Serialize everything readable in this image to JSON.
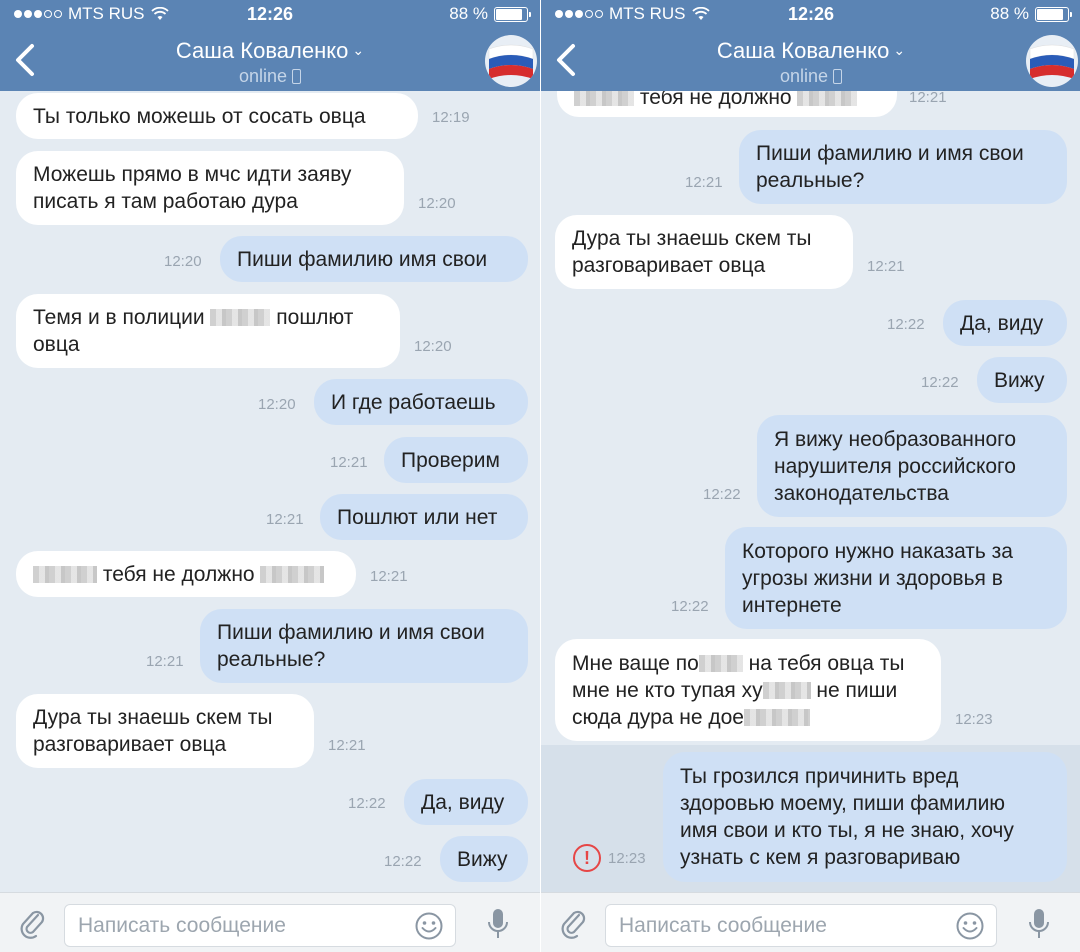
{
  "status_bar": {
    "carrier": "MTS RUS",
    "time": "12:26",
    "battery": "88 %",
    "battery_level": 0.88
  },
  "header": {
    "contact_name": "Саша Коваленко",
    "contact_status": "online",
    "icons": [
      "back-chevron-icon",
      "chevron-down-icon",
      "mobile-phone-icon",
      "avatar-russian-flag"
    ]
  },
  "composer": {
    "placeholder": "Написать сообщение",
    "icons": [
      "paperclip-icon",
      "emoji-icon",
      "microphone-icon"
    ]
  },
  "colors": {
    "header": "#5b84b4",
    "background": "#e4ebf2",
    "bubble_in": "#ffffff",
    "bubble_out": "#cfe0f5",
    "time_text": "#9aa5b1",
    "error": "#e64646"
  },
  "screens": [
    {
      "messages": [
        {
          "dir": "in",
          "text": "Ты только можешь от сосать овца",
          "time": "12:19"
        },
        {
          "dir": "in",
          "text": "Можешь прямо в мчс идти заяву\nписать я там работаю дура",
          "time": "12:20"
        },
        {
          "dir": "out",
          "text": "Пиши фамилию имя свои",
          "time": "12:20"
        },
        {
          "dir": "in",
          "text": "Темя и в полиции [censored] пошлют\nовца",
          "time": "12:20"
        },
        {
          "dir": "out",
          "text": "И где работаешь",
          "time": "12:20"
        },
        {
          "dir": "out",
          "text": "Проверим",
          "time": "12:21"
        },
        {
          "dir": "out",
          "text": "Пошлют или нет",
          "time": "12:21"
        },
        {
          "dir": "in",
          "text": "[censored] тебя не должно [censored]",
          "time": "12:21"
        },
        {
          "dir": "out",
          "text": "Пиши фамилию и имя свои\nреальные?",
          "time": "12:21"
        },
        {
          "dir": "in",
          "text": "Дура ты знаешь скем ты\nразговаривает овца",
          "time": "12:21"
        },
        {
          "dir": "out",
          "text": "Да, виду",
          "time": "12:22"
        },
        {
          "dir": "out",
          "text": "Вижу",
          "time": "12:22"
        }
      ]
    },
    {
      "messages": [
        {
          "dir": "in",
          "text": "[censored] тебя не должно [censored]",
          "time": "12:21"
        },
        {
          "dir": "out",
          "text": "Пиши фамилию и имя свои\nреальные?",
          "time": "12:21"
        },
        {
          "dir": "in",
          "text": "Дура ты знаешь скем ты\nразговаривает овца",
          "time": "12:21"
        },
        {
          "dir": "out",
          "text": "Да, виду",
          "time": "12:22"
        },
        {
          "dir": "out",
          "text": "Вижу",
          "time": "12:22"
        },
        {
          "dir": "out",
          "text": "Я вижу необразованного\nнарушителя российского\nзаконодательства",
          "time": "12:22"
        },
        {
          "dir": "out",
          "text": "Которого нужно наказать за\nугрозы жизни и здоровья в\nинтернете",
          "time": "12:22"
        },
        {
          "dir": "in",
          "text": "Мне ваще по[censored] на тебя овца ты\nмне не кто тупая ху[censored] не пиши\nсюда дура не дое[censored]",
          "time": "12:23"
        },
        {
          "dir": "out",
          "text": "Ты грозился причинить вред\nздоровью моему, пиши фамилию\nимя свои и кто ты, я не знаю, хочу\nузнать с кем я разговариваю",
          "time": "12:23",
          "failed": true
        }
      ]
    }
  ]
}
